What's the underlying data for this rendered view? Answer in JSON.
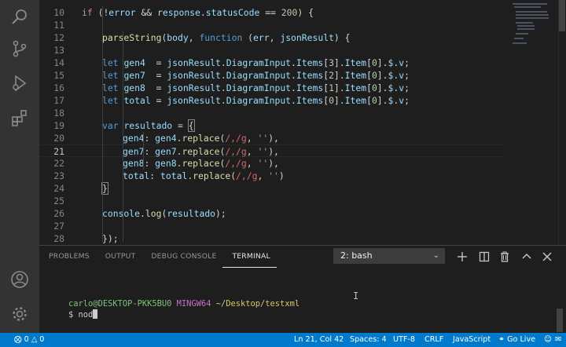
{
  "editor": {
    "lines": [
      {
        "n": "10",
        "tokens": [
          [
            "tok-ctrl",
            "if"
          ],
          [
            "tok-p",
            " ("
          ],
          [
            "tok-p",
            "!"
          ],
          [
            "tok-var",
            "error"
          ],
          [
            "tok-p",
            " && "
          ],
          [
            "tok-var",
            "response"
          ],
          [
            "tok-p",
            "."
          ],
          [
            "tok-var",
            "statusCode"
          ],
          [
            "tok-p",
            " == "
          ],
          [
            "tok-num",
            "200"
          ],
          [
            "tok-p",
            ") {"
          ]
        ],
        "indent": 1
      },
      {
        "n": "11",
        "tokens": [],
        "indent": 0
      },
      {
        "n": "12",
        "tokens": [
          [
            "tok-fn",
            "parseString"
          ],
          [
            "tok-p",
            "("
          ],
          [
            "tok-var",
            "body"
          ],
          [
            "tok-p",
            ", "
          ],
          [
            "tok-kw",
            "function"
          ],
          [
            "tok-p",
            " ("
          ],
          [
            "tok-var",
            "err"
          ],
          [
            "tok-p",
            ", "
          ],
          [
            "tok-var",
            "jsonResult"
          ],
          [
            "tok-p",
            ") {"
          ]
        ],
        "indent": 2
      },
      {
        "n": "13",
        "tokens": [],
        "indent": 0
      },
      {
        "n": "14",
        "tokens": [
          [
            "tok-kw",
            "let"
          ],
          [
            "tok-p",
            " "
          ],
          [
            "tok-var",
            "gen4"
          ],
          [
            "tok-p",
            "  = "
          ],
          [
            "tok-var",
            "jsonResult"
          ],
          [
            "tok-p",
            "."
          ],
          [
            "tok-var",
            "DiagramInput"
          ],
          [
            "tok-p",
            "."
          ],
          [
            "tok-var",
            "Items"
          ],
          [
            "tok-p",
            "["
          ],
          [
            "tok-num",
            "3"
          ],
          [
            "tok-p",
            "]."
          ],
          [
            "tok-var",
            "Item"
          ],
          [
            "tok-p",
            "["
          ],
          [
            "tok-num",
            "0"
          ],
          [
            "tok-p",
            "]."
          ],
          [
            "tok-var",
            "$"
          ],
          [
            "tok-p",
            "."
          ],
          [
            "tok-var",
            "v"
          ],
          [
            "tok-p",
            ";"
          ]
        ],
        "indent": 2
      },
      {
        "n": "15",
        "tokens": [
          [
            "tok-kw",
            "let"
          ],
          [
            "tok-p",
            " "
          ],
          [
            "tok-var",
            "gen7"
          ],
          [
            "tok-p",
            "  = "
          ],
          [
            "tok-var",
            "jsonResult"
          ],
          [
            "tok-p",
            "."
          ],
          [
            "tok-var",
            "DiagramInput"
          ],
          [
            "tok-p",
            "."
          ],
          [
            "tok-var",
            "Items"
          ],
          [
            "tok-p",
            "["
          ],
          [
            "tok-num",
            "2"
          ],
          [
            "tok-p",
            "]."
          ],
          [
            "tok-var",
            "Item"
          ],
          [
            "tok-p",
            "["
          ],
          [
            "tok-num",
            "0"
          ],
          [
            "tok-p",
            "]."
          ],
          [
            "tok-var",
            "$"
          ],
          [
            "tok-p",
            "."
          ],
          [
            "tok-var",
            "v"
          ],
          [
            "tok-p",
            ";"
          ]
        ],
        "indent": 2
      },
      {
        "n": "16",
        "tokens": [
          [
            "tok-kw",
            "let"
          ],
          [
            "tok-p",
            " "
          ],
          [
            "tok-var",
            "gen8"
          ],
          [
            "tok-p",
            "  = "
          ],
          [
            "tok-var",
            "jsonResult"
          ],
          [
            "tok-p",
            "."
          ],
          [
            "tok-var",
            "DiagramInput"
          ],
          [
            "tok-p",
            "."
          ],
          [
            "tok-var",
            "Items"
          ],
          [
            "tok-p",
            "["
          ],
          [
            "tok-num",
            "1"
          ],
          [
            "tok-p",
            "]."
          ],
          [
            "tok-var",
            "Item"
          ],
          [
            "tok-p",
            "["
          ],
          [
            "tok-num",
            "0"
          ],
          [
            "tok-p",
            "]."
          ],
          [
            "tok-var",
            "$"
          ],
          [
            "tok-p",
            "."
          ],
          [
            "tok-var",
            "v"
          ],
          [
            "tok-p",
            ";"
          ]
        ],
        "indent": 2
      },
      {
        "n": "17",
        "tokens": [
          [
            "tok-kw",
            "let"
          ],
          [
            "tok-p",
            " "
          ],
          [
            "tok-var",
            "total"
          ],
          [
            "tok-p",
            " = "
          ],
          [
            "tok-var",
            "jsonResult"
          ],
          [
            "tok-p",
            "."
          ],
          [
            "tok-var",
            "DiagramInput"
          ],
          [
            "tok-p",
            "."
          ],
          [
            "tok-var",
            "Items"
          ],
          [
            "tok-p",
            "["
          ],
          [
            "tok-num",
            "0"
          ],
          [
            "tok-p",
            "]."
          ],
          [
            "tok-var",
            "Item"
          ],
          [
            "tok-p",
            "["
          ],
          [
            "tok-num",
            "0"
          ],
          [
            "tok-p",
            "]."
          ],
          [
            "tok-var",
            "$"
          ],
          [
            "tok-p",
            "."
          ],
          [
            "tok-var",
            "v"
          ],
          [
            "tok-p",
            ";"
          ]
        ],
        "indent": 2
      },
      {
        "n": "18",
        "tokens": [],
        "indent": 0
      },
      {
        "n": "19",
        "tokens": [
          [
            "tok-kw",
            "var"
          ],
          [
            "tok-p",
            " "
          ],
          [
            "tok-var",
            "resultado"
          ],
          [
            "tok-p",
            " = "
          ],
          [
            "tok-brk",
            "{"
          ]
        ],
        "indent": 2
      },
      {
        "n": "20",
        "tokens": [
          [
            "tok-var",
            "gen4"
          ],
          [
            "tok-p",
            ": "
          ],
          [
            "tok-var",
            "gen4"
          ],
          [
            "tok-p",
            "."
          ],
          [
            "tok-fn",
            "replace"
          ],
          [
            "tok-p",
            "("
          ],
          [
            "tok-re",
            "/,/g"
          ],
          [
            "tok-p",
            ", "
          ],
          [
            "tok-str",
            "''"
          ],
          [
            "tok-p",
            "),"
          ]
        ],
        "indent": 3
      },
      {
        "n": "21",
        "tokens": [
          [
            "tok-var",
            "gen7"
          ],
          [
            "tok-p",
            ": "
          ],
          [
            "tok-var",
            "gen7"
          ],
          [
            "tok-p",
            "."
          ],
          [
            "tok-fn",
            "replace"
          ],
          [
            "tok-p",
            "("
          ],
          [
            "tok-re",
            "/,/g"
          ],
          [
            "tok-p",
            ", "
          ],
          [
            "tok-str",
            "''"
          ],
          [
            "tok-p",
            "),"
          ]
        ],
        "indent": 3,
        "current": true
      },
      {
        "n": "22",
        "tokens": [
          [
            "tok-var",
            "gen8"
          ],
          [
            "tok-p",
            ": "
          ],
          [
            "tok-var",
            "gen8"
          ],
          [
            "tok-p",
            "."
          ],
          [
            "tok-fn",
            "replace"
          ],
          [
            "tok-p",
            "("
          ],
          [
            "tok-re",
            "/,/g"
          ],
          [
            "tok-p",
            ", "
          ],
          [
            "tok-str",
            "''"
          ],
          [
            "tok-p",
            "),"
          ]
        ],
        "indent": 3
      },
      {
        "n": "23",
        "tokens": [
          [
            "tok-var",
            "total"
          ],
          [
            "tok-p",
            ": "
          ],
          [
            "tok-var",
            "total"
          ],
          [
            "tok-p",
            "."
          ],
          [
            "tok-fn",
            "replace"
          ],
          [
            "tok-p",
            "("
          ],
          [
            "tok-re",
            "/,/g"
          ],
          [
            "tok-p",
            ", "
          ],
          [
            "tok-str",
            "''"
          ],
          [
            "tok-p",
            ")"
          ]
        ],
        "indent": 3
      },
      {
        "n": "24",
        "tokens": [
          [
            "tok-brk",
            "}"
          ]
        ],
        "indent": 2
      },
      {
        "n": "25",
        "tokens": [],
        "indent": 0
      },
      {
        "n": "26",
        "tokens": [
          [
            "tok-var",
            "console"
          ],
          [
            "tok-p",
            "."
          ],
          [
            "tok-fn",
            "log"
          ],
          [
            "tok-p",
            "("
          ],
          [
            "tok-var",
            "resultado"
          ],
          [
            "tok-p",
            ");"
          ]
        ],
        "indent": 2
      },
      {
        "n": "27",
        "tokens": [],
        "indent": 0
      },
      {
        "n": "28",
        "tokens": [
          [
            "tok-p",
            "});"
          ]
        ],
        "indent": 2
      }
    ]
  },
  "panel": {
    "tabs": [
      {
        "id": "problems",
        "label": "PROBLEMS",
        "active": false
      },
      {
        "id": "output",
        "label": "OUTPUT",
        "active": false
      },
      {
        "id": "debug-console",
        "label": "DEBUG CONSOLE",
        "active": false
      },
      {
        "id": "terminal",
        "label": "TERMINAL",
        "active": true
      }
    ],
    "terminal_select": "2: bash",
    "actions": [
      "add-icon",
      "split-icon",
      "trash-icon",
      "chevron-up-icon",
      "close-icon"
    ]
  },
  "terminal": {
    "user": "carlo@DESKTOP-PKK5BU0",
    "host": "MINGW64",
    "path": "~/Desktop/testxml",
    "prompt": "$ ",
    "input": "nod"
  },
  "activity": [
    "search-icon",
    "source-control-icon",
    "run-debug-icon",
    "extensions-icon",
    "account-icon",
    "settings-gear-icon"
  ],
  "statusbar": {
    "errors": "0",
    "warnings": "0",
    "position": "Ln 21, Col 42",
    "spaces": "Spaces: 4",
    "encoding": "UTF-8",
    "eol": "CRLF",
    "language": "JavaScript",
    "live": "Go Live"
  },
  "colors": {
    "accent": "#007acc",
    "activity_bg": "#333333",
    "editor_bg": "#1e1e1e"
  }
}
